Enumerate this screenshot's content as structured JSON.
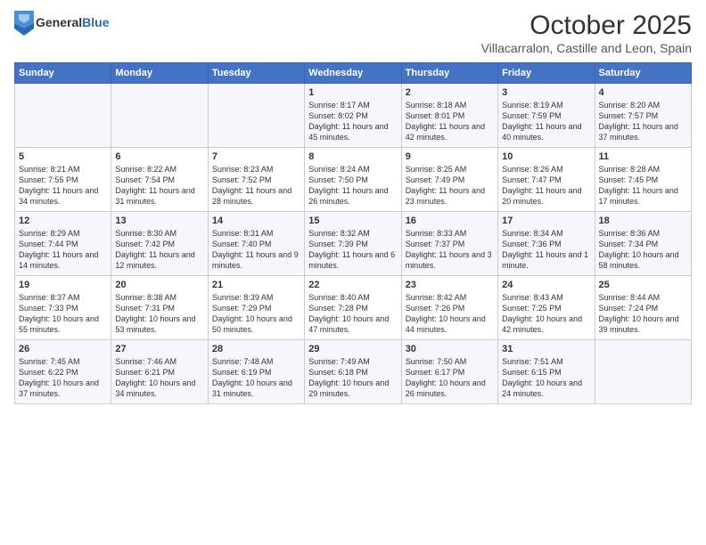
{
  "header": {
    "logo_line1": "General",
    "logo_line2": "Blue",
    "month": "October 2025",
    "location": "Villacarralon, Castille and Leon, Spain"
  },
  "weekdays": [
    "Sunday",
    "Monday",
    "Tuesday",
    "Wednesday",
    "Thursday",
    "Friday",
    "Saturday"
  ],
  "weeks": [
    [
      {
        "day": "",
        "info": ""
      },
      {
        "day": "",
        "info": ""
      },
      {
        "day": "",
        "info": ""
      },
      {
        "day": "1",
        "info": "Sunrise: 8:17 AM\nSunset: 8:02 PM\nDaylight: 11 hours and 45 minutes."
      },
      {
        "day": "2",
        "info": "Sunrise: 8:18 AM\nSunset: 8:01 PM\nDaylight: 11 hours and 42 minutes."
      },
      {
        "day": "3",
        "info": "Sunrise: 8:19 AM\nSunset: 7:59 PM\nDaylight: 11 hours and 40 minutes."
      },
      {
        "day": "4",
        "info": "Sunrise: 8:20 AM\nSunset: 7:57 PM\nDaylight: 11 hours and 37 minutes."
      }
    ],
    [
      {
        "day": "5",
        "info": "Sunrise: 8:21 AM\nSunset: 7:55 PM\nDaylight: 11 hours and 34 minutes."
      },
      {
        "day": "6",
        "info": "Sunrise: 8:22 AM\nSunset: 7:54 PM\nDaylight: 11 hours and 31 minutes."
      },
      {
        "day": "7",
        "info": "Sunrise: 8:23 AM\nSunset: 7:52 PM\nDaylight: 11 hours and 28 minutes."
      },
      {
        "day": "8",
        "info": "Sunrise: 8:24 AM\nSunset: 7:50 PM\nDaylight: 11 hours and 26 minutes."
      },
      {
        "day": "9",
        "info": "Sunrise: 8:25 AM\nSunset: 7:49 PM\nDaylight: 11 hours and 23 minutes."
      },
      {
        "day": "10",
        "info": "Sunrise: 8:26 AM\nSunset: 7:47 PM\nDaylight: 11 hours and 20 minutes."
      },
      {
        "day": "11",
        "info": "Sunrise: 8:28 AM\nSunset: 7:45 PM\nDaylight: 11 hours and 17 minutes."
      }
    ],
    [
      {
        "day": "12",
        "info": "Sunrise: 8:29 AM\nSunset: 7:44 PM\nDaylight: 11 hours and 14 minutes."
      },
      {
        "day": "13",
        "info": "Sunrise: 8:30 AM\nSunset: 7:42 PM\nDaylight: 11 hours and 12 minutes."
      },
      {
        "day": "14",
        "info": "Sunrise: 8:31 AM\nSunset: 7:40 PM\nDaylight: 11 hours and 9 minutes."
      },
      {
        "day": "15",
        "info": "Sunrise: 8:32 AM\nSunset: 7:39 PM\nDaylight: 11 hours and 6 minutes."
      },
      {
        "day": "16",
        "info": "Sunrise: 8:33 AM\nSunset: 7:37 PM\nDaylight: 11 hours and 3 minutes."
      },
      {
        "day": "17",
        "info": "Sunrise: 8:34 AM\nSunset: 7:36 PM\nDaylight: 11 hours and 1 minute."
      },
      {
        "day": "18",
        "info": "Sunrise: 8:36 AM\nSunset: 7:34 PM\nDaylight: 10 hours and 58 minutes."
      }
    ],
    [
      {
        "day": "19",
        "info": "Sunrise: 8:37 AM\nSunset: 7:33 PM\nDaylight: 10 hours and 55 minutes."
      },
      {
        "day": "20",
        "info": "Sunrise: 8:38 AM\nSunset: 7:31 PM\nDaylight: 10 hours and 53 minutes."
      },
      {
        "day": "21",
        "info": "Sunrise: 8:39 AM\nSunset: 7:29 PM\nDaylight: 10 hours and 50 minutes."
      },
      {
        "day": "22",
        "info": "Sunrise: 8:40 AM\nSunset: 7:28 PM\nDaylight: 10 hours and 47 minutes."
      },
      {
        "day": "23",
        "info": "Sunrise: 8:42 AM\nSunset: 7:26 PM\nDaylight: 10 hours and 44 minutes."
      },
      {
        "day": "24",
        "info": "Sunrise: 8:43 AM\nSunset: 7:25 PM\nDaylight: 10 hours and 42 minutes."
      },
      {
        "day": "25",
        "info": "Sunrise: 8:44 AM\nSunset: 7:24 PM\nDaylight: 10 hours and 39 minutes."
      }
    ],
    [
      {
        "day": "26",
        "info": "Sunrise: 7:45 AM\nSunset: 6:22 PM\nDaylight: 10 hours and 37 minutes."
      },
      {
        "day": "27",
        "info": "Sunrise: 7:46 AM\nSunset: 6:21 PM\nDaylight: 10 hours and 34 minutes."
      },
      {
        "day": "28",
        "info": "Sunrise: 7:48 AM\nSunset: 6:19 PM\nDaylight: 10 hours and 31 minutes."
      },
      {
        "day": "29",
        "info": "Sunrise: 7:49 AM\nSunset: 6:18 PM\nDaylight: 10 hours and 29 minutes."
      },
      {
        "day": "30",
        "info": "Sunrise: 7:50 AM\nSunset: 6:17 PM\nDaylight: 10 hours and 26 minutes."
      },
      {
        "day": "31",
        "info": "Sunrise: 7:51 AM\nSunset: 6:15 PM\nDaylight: 10 hours and 24 minutes."
      },
      {
        "day": "",
        "info": ""
      }
    ]
  ]
}
